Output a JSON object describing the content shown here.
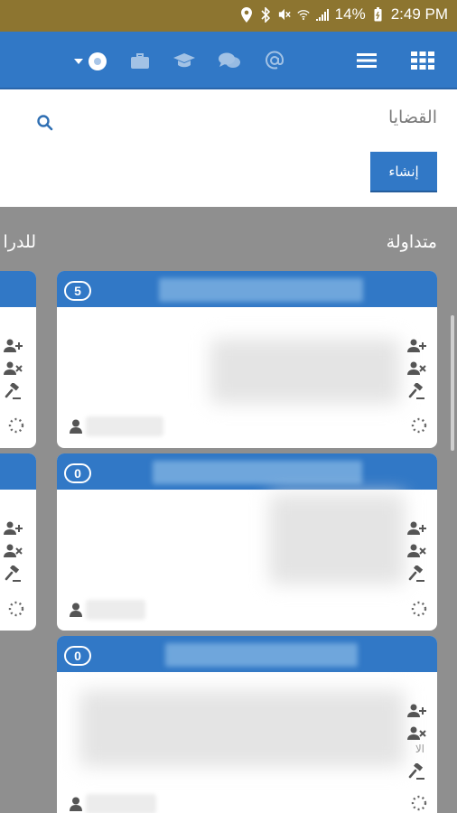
{
  "status_bar": {
    "battery": "14%",
    "time": "2:49 PM",
    "icons": [
      "location-icon",
      "bluetooth-icon",
      "mute-icon",
      "wifi-icon",
      "signal-icon",
      "battery-icon"
    ]
  },
  "topbar": {
    "notification_badge": "",
    "icons": [
      "user-menu-icon",
      "briefcase-icon",
      "graduation-cap-icon",
      "chat-icon",
      "at-icon",
      "menu-icon",
      "grid-icon"
    ]
  },
  "header": {
    "title": "القضايا",
    "create_label": "إنشاء"
  },
  "columns": [
    {
      "title": "متداولة",
      "cards": [
        {
          "count": "5",
          "note": ""
        },
        {
          "count": "0",
          "note": ""
        },
        {
          "count": "0",
          "note": "الا"
        }
      ]
    },
    {
      "title": "للدرا"
    }
  ],
  "colors": {
    "status_bar": "#8d7530",
    "primary": "#3178c6",
    "board": "#8f8f8f",
    "card": "#ffffff",
    "icon": "#555555"
  }
}
